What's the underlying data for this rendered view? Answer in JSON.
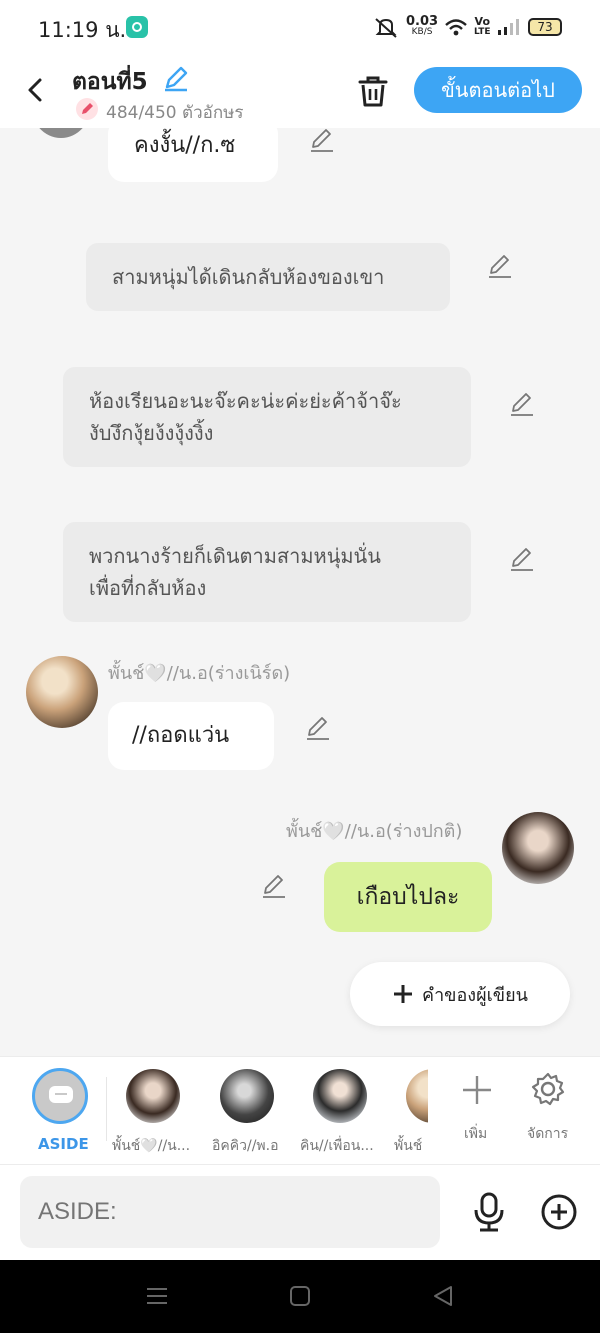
{
  "status_bar": {
    "time": "11:19 น.",
    "net_speed": "0.03",
    "net_unit": "KB/S",
    "volte_top": "Vo",
    "volte_bottom": "LTE",
    "battery": "73"
  },
  "header": {
    "title": "ตอนที่5",
    "char_count": "484/450 ตัวอักษร",
    "next_button": "ขั้นตอนต่อไป"
  },
  "messages": {
    "m1_text": "คงงั้น//ก.ซ",
    "n1_text": "สามหนุ่มได้เดินกลับห้องของเขา",
    "n2_line1": "ห้องเรียนอะนะจ๊ะคะน่ะค่ะย่ะค้าจ้าจ๊ะ",
    "n2_line2": "งับงึกงุ้ยง้งงุ้งงิ้ง",
    "n3_line1": "พวกนางร้ายก็เดินตามสามหนุ่มนั่น",
    "n3_line2": "เพื่อที่กลับห้อง",
    "m2_sender": "พั้นช์🤍//น.อ(ร่างเนิร์ด)",
    "m2_text": "//ถอดแว่น",
    "m3_sender": "พั้นช์🤍//น.อ(ร่างปกติ)",
    "m3_text": "เกือบไปละ",
    "author_button": "คำของผู้เขียน"
  },
  "character_bar": {
    "aside_label": "ASIDE",
    "characters": [
      "พั้นช์🤍//น...",
      "อิคคิว//พ.อ",
      "คิน//เพื่อน...",
      "พั้นช์"
    ],
    "add_label": "เพิ่ม",
    "manage_label": "จัดการ"
  },
  "input_bar": {
    "placeholder": "ASIDE:"
  },
  "colors": {
    "accent_blue": "#3da5f4",
    "green_bubble": "#d9f29a",
    "narration_bg": "#ebebeb"
  }
}
